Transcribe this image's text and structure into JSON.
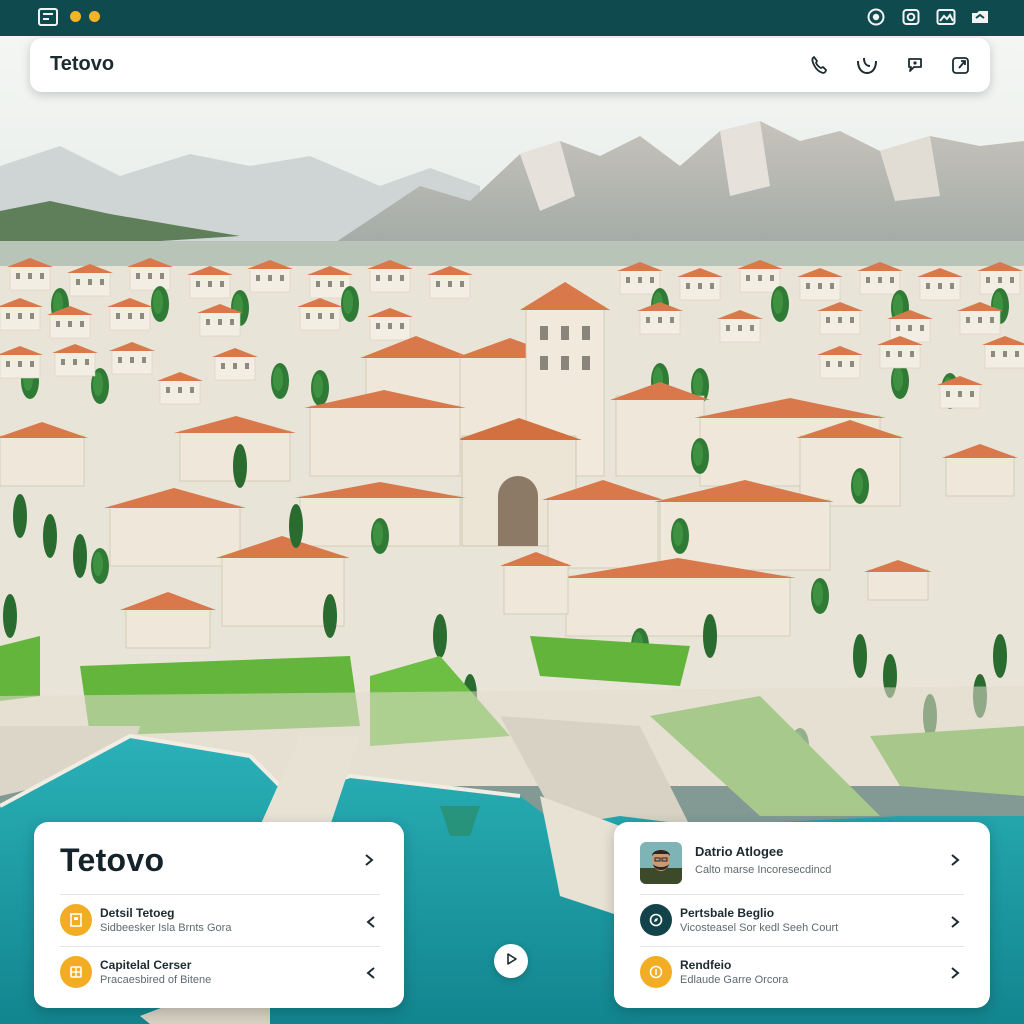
{
  "header": {
    "title": "Tetovo",
    "icons": [
      "phone-icon",
      "headset-icon",
      "chat-icon",
      "share-icon"
    ]
  },
  "topbar": {
    "icons": [
      "app-icon",
      "window-dot",
      "window-dot",
      "record-icon",
      "camera-icon",
      "image-icon",
      "folder-icon"
    ],
    "dot_color": "#f5b32a"
  },
  "card_left": {
    "title": "Tetovo",
    "items": [
      {
        "title": "Detsil Tetoeg",
        "subtitle": "Sidbeesker Isla Brnts Gora",
        "icon": "building-icon"
      },
      {
        "title": "Capitelal Cerser",
        "subtitle": "Pracaesbired of Bitene",
        "icon": "grid-icon"
      }
    ]
  },
  "card_right": {
    "profile": {
      "name": "Datrio Atlogee",
      "subtitle": "Calto marse Incoresecdincd"
    },
    "items": [
      {
        "title": "Pertsbale Beglio",
        "subtitle": "Vicosteasel Sor kedl Seeh Court",
        "icon": "compass-icon"
      },
      {
        "title": "Rendfeio",
        "subtitle": "Edlaude Garre Orcora",
        "icon": "coin-icon"
      }
    ]
  },
  "play_button": {
    "icon": "play-icon"
  },
  "colors": {
    "accent_teal": "#0f4b4e",
    "accent_amber": "#f2ad24",
    "roof": "#d9784a",
    "water": "#1fa3ad"
  }
}
